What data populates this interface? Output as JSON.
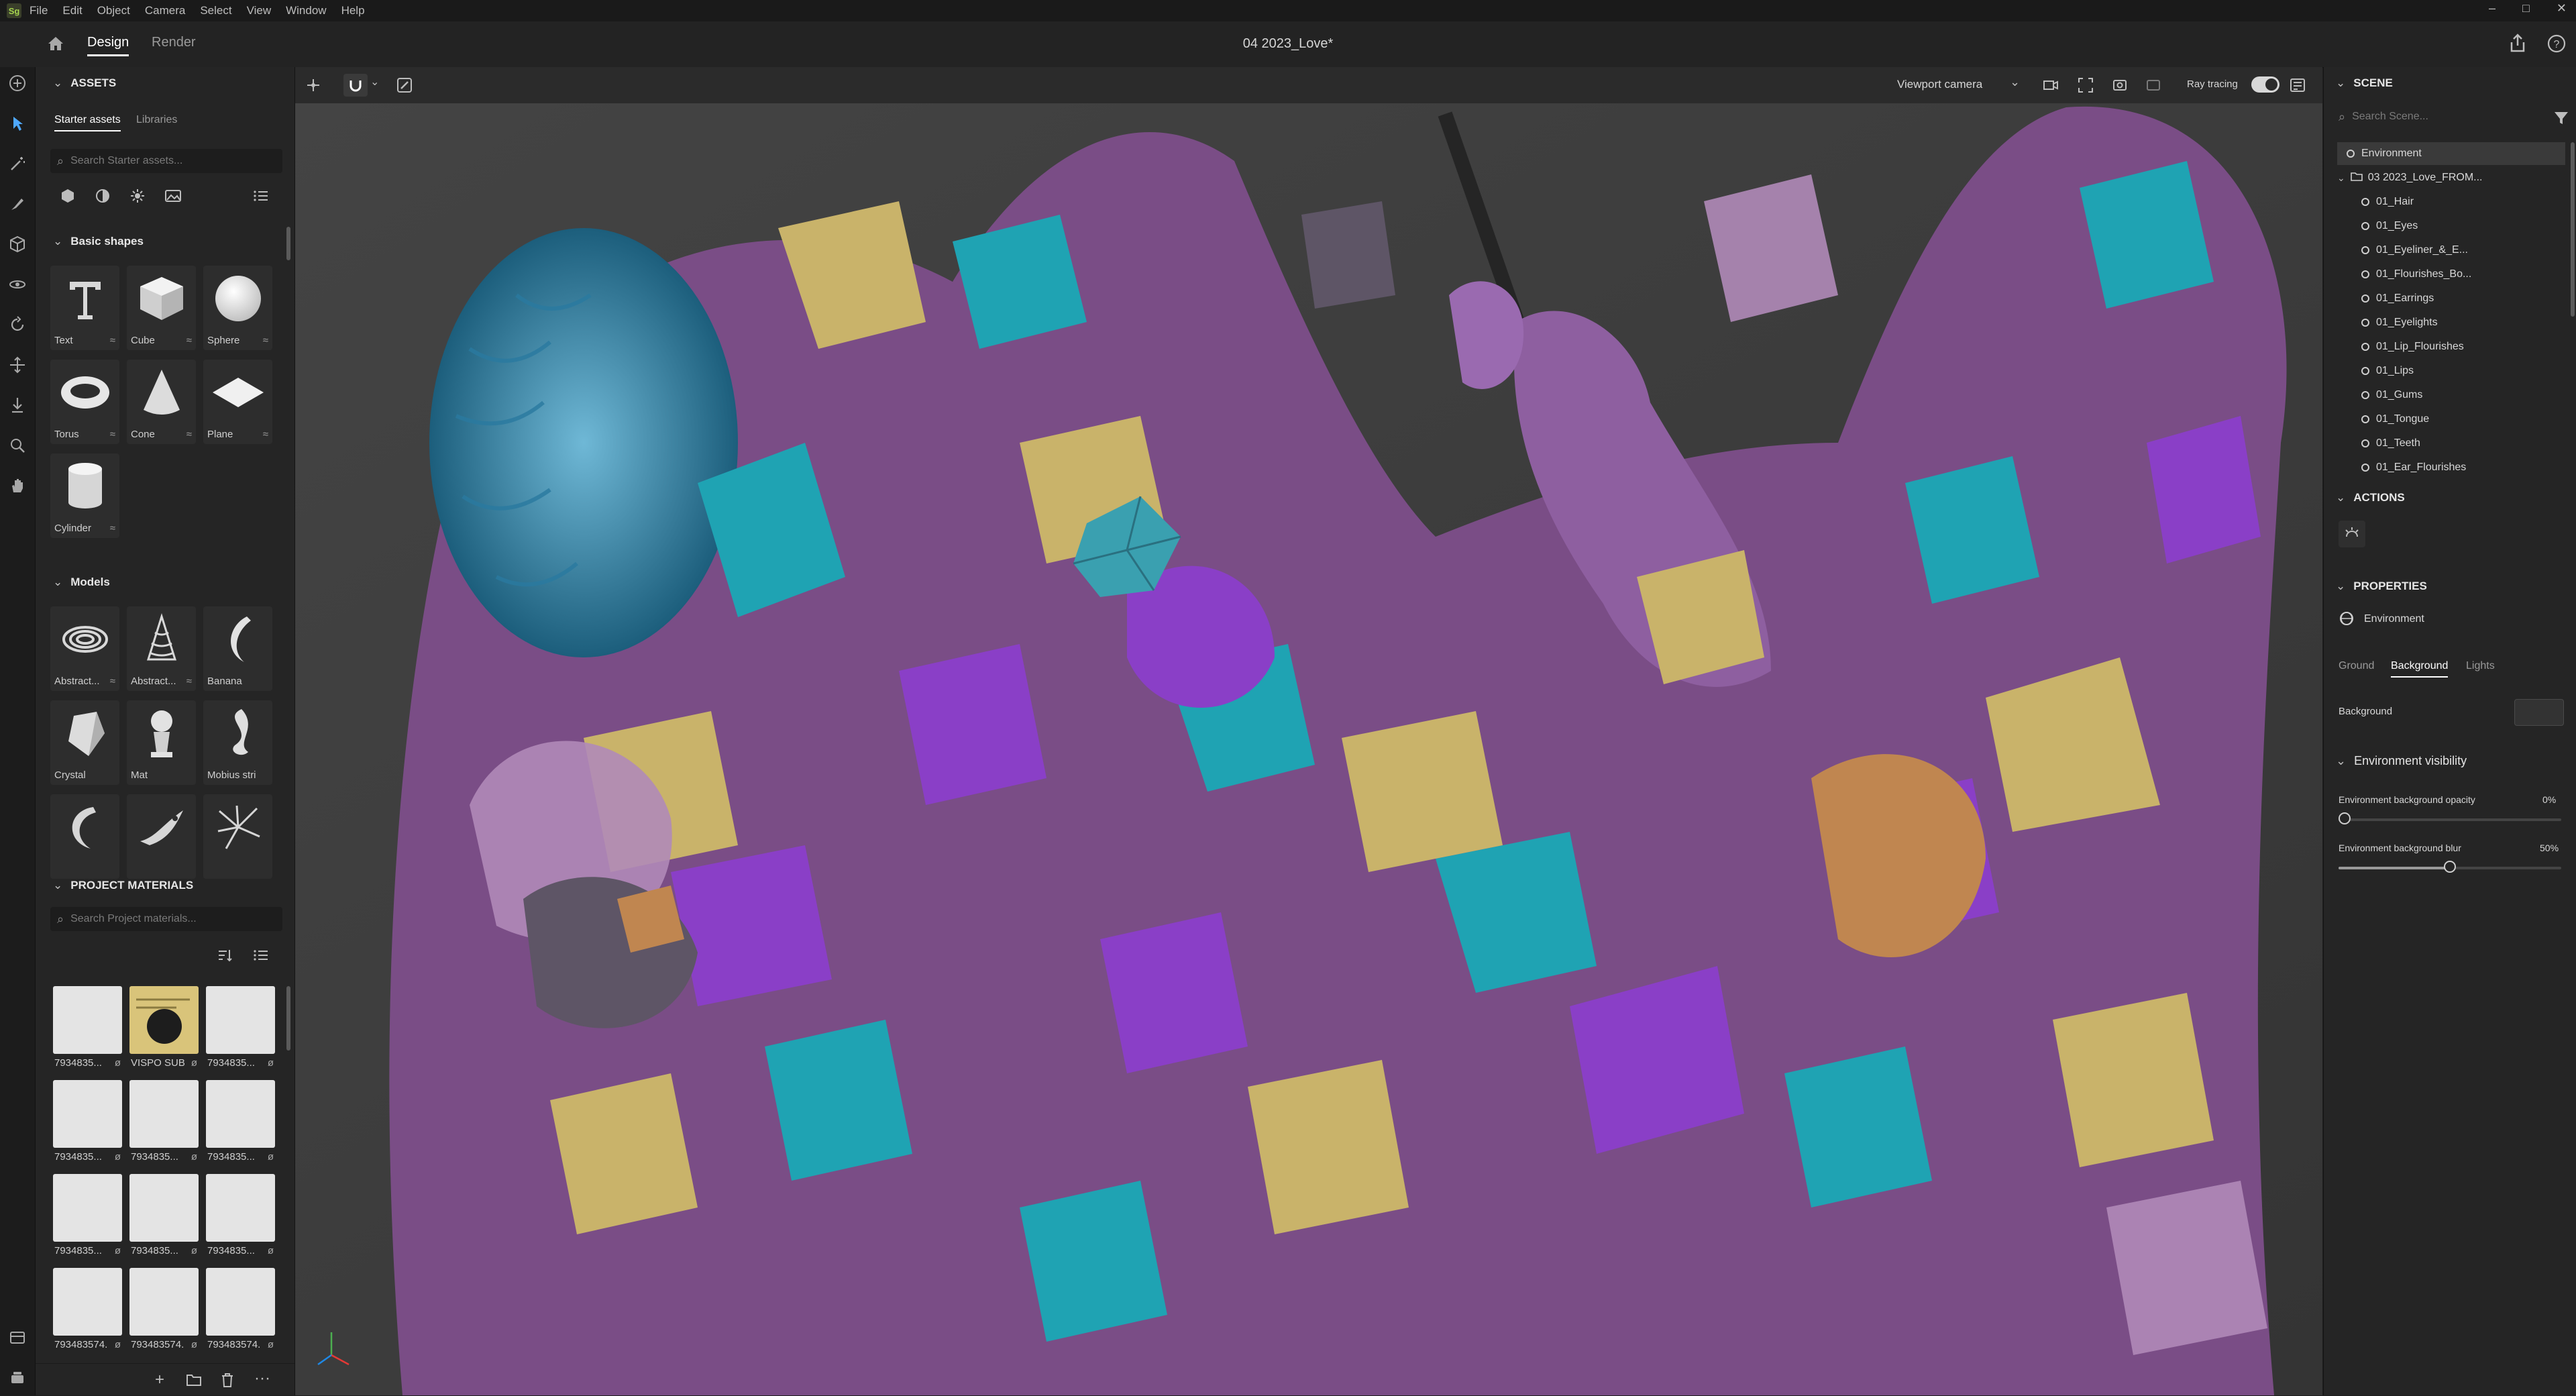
{
  "menu": {
    "logo": "Sg",
    "items": [
      "File",
      "Edit",
      "Object",
      "Camera",
      "Select",
      "View",
      "Window",
      "Help"
    ]
  },
  "window_controls": [
    "–",
    "□",
    "✕"
  ],
  "topbar": {
    "tabs": [
      "Design",
      "Render"
    ],
    "active_tab": "Design",
    "doc_title": "04 2023_Love*"
  },
  "toolbar": {
    "tools": [
      "add-icon",
      "select-icon",
      "magic-wand-icon",
      "paint-icon",
      "cube-icon",
      "orbit-icon",
      "rotate-icon",
      "move-icon",
      "drop-icon",
      "zoom-icon",
      "hand-icon"
    ]
  },
  "assets": {
    "header": "ASSETS",
    "tabs": [
      "Starter assets",
      "Libraries"
    ],
    "active_tab": "Starter assets",
    "search_placeholder": "Search Starter assets...",
    "basic_shapes_header": "Basic shapes",
    "basic_shapes": [
      {
        "label": "Text",
        "icon": "text-shape"
      },
      {
        "label": "Cube",
        "icon": "cube-shape"
      },
      {
        "label": "Sphere",
        "icon": "sphere-shape"
      },
      {
        "label": "Torus",
        "icon": "torus-shape"
      },
      {
        "label": "Cone",
        "icon": "cone-shape"
      },
      {
        "label": "Plane",
        "icon": "plane-shape"
      },
      {
        "label": "Cylinder",
        "icon": "cylinder-shape"
      }
    ],
    "models_header": "Models",
    "models": [
      {
        "label": "Abstract..."
      },
      {
        "label": "Abstract..."
      },
      {
        "label": "Banana"
      },
      {
        "label": "Crystal"
      },
      {
        "label": "Mat"
      },
      {
        "label": "Mobius strip"
      },
      {
        "label": ""
      },
      {
        "label": ""
      },
      {
        "label": ""
      }
    ],
    "project_materials_header": "PROJECT MATERIALS",
    "materials_search_placeholder": "Search Project materials...",
    "materials": [
      {
        "label": "7934835..."
      },
      {
        "label": "VISPO SUB..."
      },
      {
        "label": "7934835..."
      },
      {
        "label": "7934835..."
      },
      {
        "label": "7934835..."
      },
      {
        "label": "7934835..."
      },
      {
        "label": "7934835..."
      },
      {
        "label": "7934835..."
      },
      {
        "label": "7934835..."
      },
      {
        "label": "793483574..."
      },
      {
        "label": "793483574..."
      },
      {
        "label": "793483574..."
      }
    ],
    "footer_icons": [
      "+",
      "folder-icon",
      "trash-icon",
      "more-icon"
    ]
  },
  "viewport": {
    "camera_label": "Viewport camera",
    "ray_tracing_label": "Ray tracing",
    "ray_tracing_on": true
  },
  "scene": {
    "header": "SCENE",
    "search_placeholder": "Search Scene...",
    "items": [
      {
        "label": "Environment",
        "selected": true,
        "indent": 0
      },
      {
        "label": "03 2023_Love_FROM...",
        "indent": 0,
        "group": true
      },
      {
        "label": "01_Hair",
        "indent": 1
      },
      {
        "label": "01_Eyes",
        "indent": 1
      },
      {
        "label": "01_Eyeliner_&_E...",
        "indent": 1
      },
      {
        "label": "01_Flourishes_Bo...",
        "indent": 1
      },
      {
        "label": "01_Earrings",
        "indent": 1
      },
      {
        "label": "01_Eyelights",
        "indent": 1
      },
      {
        "label": "01_Lip_Flourishes",
        "indent": 1
      },
      {
        "label": "01_Lips",
        "indent": 1
      },
      {
        "label": "01_Gums",
        "indent": 1
      },
      {
        "label": "01_Tongue",
        "indent": 1
      },
      {
        "label": "01_Teeth",
        "indent": 1
      },
      {
        "label": "01_Ear_Flourishes",
        "indent": 1
      }
    ]
  },
  "actions": {
    "header": "ACTIONS"
  },
  "properties": {
    "header": "PROPERTIES",
    "object_name": "Environment",
    "tabs": [
      "Ground",
      "Background",
      "Lights"
    ],
    "active_tab": "Background",
    "background_label": "Background",
    "env_visibility_header": "Environment visibility",
    "opacity_label": "Environment background opacity",
    "opacity_value": "0%",
    "opacity_fraction": 0,
    "blur_label": "Environment background blur",
    "blur_value": "50%",
    "blur_fraction": 0.5
  },
  "colors": {
    "accent": "#ffffff",
    "purple": "#8a3fc7",
    "teal": "#1fa3b3",
    "gold": "#c9b36a",
    "lavender": "#b08ab8"
  }
}
